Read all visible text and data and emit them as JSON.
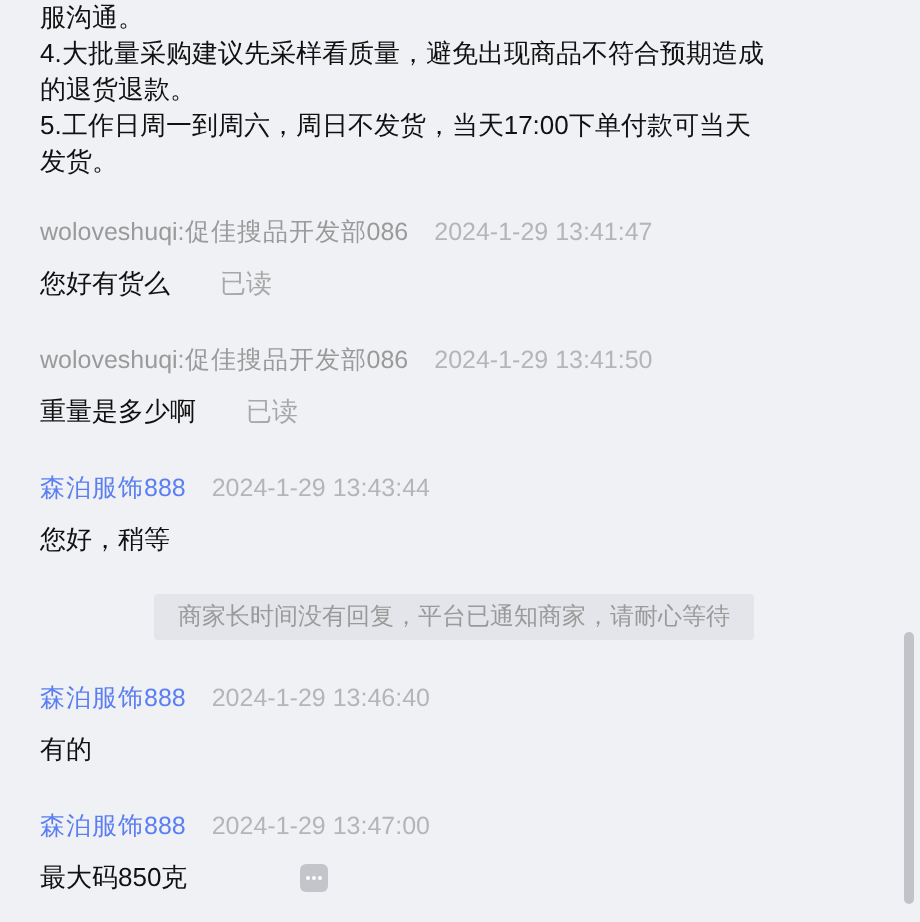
{
  "intro": {
    "paragraphs": [
      "服沟通。",
      "4.大批量采购建议先采样看质量，避免出现商品不符合预期造成的退货退款。",
      "5.工作日周一到周六，周日不发货，当天17:00下单付款可当天发货。"
    ]
  },
  "messages": [
    {
      "kind": "buyer",
      "sender": "woloveshuqi:促佳搜品开发部086",
      "time": "2024-1-29 13:41:47",
      "text": "您好有货么",
      "status": "已读"
    },
    {
      "kind": "buyer",
      "sender": "woloveshuqi:促佳搜品开发部086",
      "time": "2024-1-29 13:41:50",
      "text": "重量是多少啊",
      "status": "已读"
    },
    {
      "kind": "seller",
      "sender": "森泊服饰888",
      "time": "2024-1-29 13:43:44",
      "text": "您好，稍等"
    },
    {
      "kind": "notice",
      "text": "商家长时间没有回复，平台已通知商家，请耐心等待"
    },
    {
      "kind": "seller",
      "sender": "森泊服饰888",
      "time": "2024-1-29 13:46:40",
      "text": "有的"
    },
    {
      "kind": "seller",
      "sender": "森泊服饰888",
      "time": "2024-1-29 13:47:00",
      "text": "最大码850克",
      "more_menu": true
    }
  ]
}
